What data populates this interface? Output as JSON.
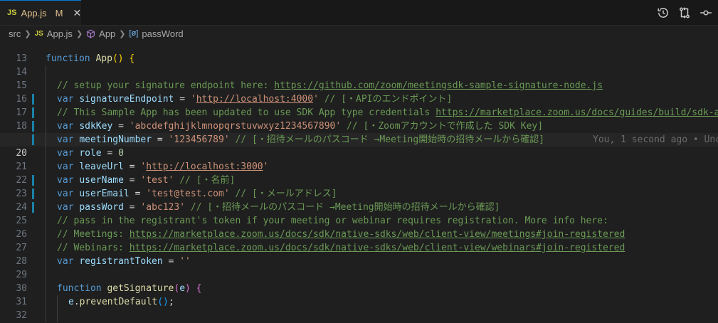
{
  "tab": {
    "js_badge": "JS",
    "filename": "App.js",
    "modified": "M",
    "close": "✕"
  },
  "breadcrumb": {
    "folder": "src",
    "file_badge": "JS",
    "file": "App.js",
    "symbol": "App",
    "variable_icon": "[ø]",
    "variable": "passWord"
  },
  "editor": {
    "active_line": "20",
    "blame": "You, 1 second ago • Unc",
    "lines": {
      "l13": {
        "num": "13"
      },
      "l14": {
        "num": "14",
        "kw": "function",
        "name": "App",
        "paren": "()",
        "brace": "{"
      },
      "l15": {
        "num": "15"
      },
      "l16": {
        "num": "16",
        "comment": "// setup your signature endpoint here: ",
        "url": "https://github.com/zoom/meetingsdk-sample-signature-node.js"
      },
      "l17": {
        "num": "17",
        "kw": "var",
        "name": "signatureEndpoint",
        "eq": " = ",
        "q1": "'",
        "url": "http://localhost:4000",
        "q2": "'",
        "comment": " // [・APIのエンドポイント]"
      },
      "l18": {
        "num": "18",
        "comment": "// This Sample App has been updated to use SDK App type credentials ",
        "url": "https://marketplace.zoom.us/docs/guides/build/sdk-app"
      },
      "l19": {
        "num": "19",
        "kw": "var",
        "name": "sdkKey",
        "eq": " = ",
        "str": "'abcdefghijklmnopqrstuvwxyz1234567890'",
        "comment": " // [・Zoomアカウントで作成した SDK Key]"
      },
      "l20": {
        "num": "20",
        "kw": "var",
        "name": "meetingNumber",
        "eq": " = ",
        "str": "'123456789'",
        "comment": " // [・招待メールのパスコード →Meeting開始時の招待メールから確認]"
      },
      "l21": {
        "num": "21",
        "kw": "var",
        "name": "role",
        "eq": " = ",
        "num_val": "0"
      },
      "l22": {
        "num": "22",
        "kw": "var",
        "name": "leaveUrl",
        "eq": " = ",
        "q1": "'",
        "url": "http://localhost:3000",
        "q2": "'"
      },
      "l23": {
        "num": "23",
        "kw": "var",
        "name": "userName",
        "eq": " = ",
        "str": "'test'",
        "comment": " // [・名前]"
      },
      "l24": {
        "num": "24",
        "kw": "var",
        "name": "userEmail",
        "eq": " = ",
        "str": "'test@test.com'",
        "comment": " // [・メールアドレス]"
      },
      "l25": {
        "num": "25",
        "kw": "var",
        "name": "passWord",
        "eq": " = ",
        "str": "'abc123'",
        "comment": " // [・招待メールのパスコード →Meeting開始時の招待メールから確認]"
      },
      "l26": {
        "num": "26",
        "comment": "// pass in the registrant's token if your meeting or webinar requires registration. More info here:"
      },
      "l27": {
        "num": "27",
        "comment": "// Meetings: ",
        "url": "https://marketplace.zoom.us/docs/sdk/native-sdks/web/client-view/meetings#join-registered"
      },
      "l28": {
        "num": "28",
        "comment": "// Webinars: ",
        "url": "https://marketplace.zoom.us/docs/sdk/native-sdks/web/client-view/webinars#join-registered"
      },
      "l29": {
        "num": "29",
        "kw": "var",
        "name": "registrantToken",
        "eq": " = ",
        "str": "''"
      },
      "l30": {
        "num": "30"
      },
      "l31": {
        "num": "31",
        "kw": "function",
        "name": "getSignature",
        "p1": "(",
        "arg": "e",
        "p2": ")",
        "brace": "{"
      },
      "l32": {
        "num": "32",
        "obj": "e",
        "dot": ".",
        "method": "preventDefault",
        "call": "()",
        "semi": ";"
      },
      "l33": {
        "num": "33"
      }
    }
  },
  "colors": {
    "background": "#1f1f1f",
    "keyword": "#569cd6",
    "function": "#dcdcaa",
    "variable": "#9cdcfe",
    "string": "#ce9178",
    "number": "#b5cea8",
    "comment": "#6a9955",
    "modified_gutter": "#1b81a8"
  },
  "icons": [
    "timeline-icon",
    "compare-changes-icon",
    "source-control-icon"
  ]
}
